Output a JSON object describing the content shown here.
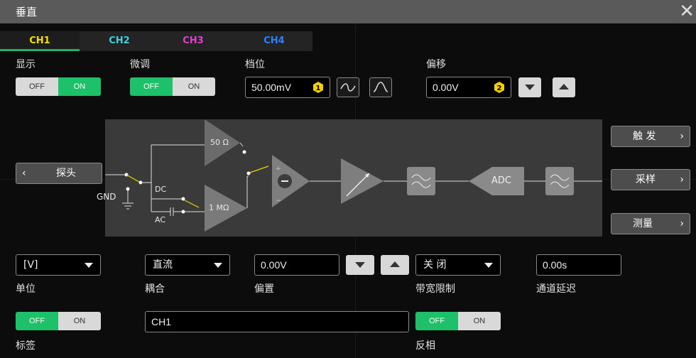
{
  "window": {
    "title": "垂直"
  },
  "tabs": [
    {
      "label": "CH1",
      "color": "#f5e000",
      "active": true
    },
    {
      "label": "CH2",
      "color": "#3fd0e0",
      "active": false
    },
    {
      "label": "CH3",
      "color": "#e040d0",
      "active": false
    },
    {
      "label": "CH4",
      "color": "#2f7fff",
      "active": false
    }
  ],
  "display": {
    "label": "显示",
    "off": "OFF",
    "on": "ON",
    "state": "on"
  },
  "fine": {
    "label": "微调",
    "off": "OFF",
    "on": "ON",
    "state": "off"
  },
  "scale": {
    "label": "档位",
    "value": "50.00mV"
  },
  "offset": {
    "label": "偏移",
    "value": "0.00V"
  },
  "diagram": {
    "probe": "探头",
    "gnd": "GND",
    "dc": "DC",
    "ac": "AC",
    "r50": "50 Ω",
    "r1m": "1 MΩ",
    "adc": "ADC"
  },
  "side": {
    "trigger": "触 发",
    "sample": "采样",
    "measure": "测量"
  },
  "unit": {
    "label": "单位",
    "value": "[V]"
  },
  "coupling": {
    "label": "耦合",
    "value": "直流"
  },
  "bias": {
    "label": "偏置",
    "value": "0.00V"
  },
  "bandwidth": {
    "label": "带宽限制",
    "value": "关 闭"
  },
  "delay": {
    "label": "通道延迟",
    "value": "0.00s"
  },
  "tag": {
    "label": "标签",
    "off": "OFF",
    "on": "ON",
    "state": "off",
    "text": "CH1"
  },
  "invert": {
    "label": "反相",
    "off": "OFF",
    "on": "ON",
    "state": "off"
  },
  "colors": {
    "accent": "#1ec06a",
    "badge": "#f5d000"
  }
}
